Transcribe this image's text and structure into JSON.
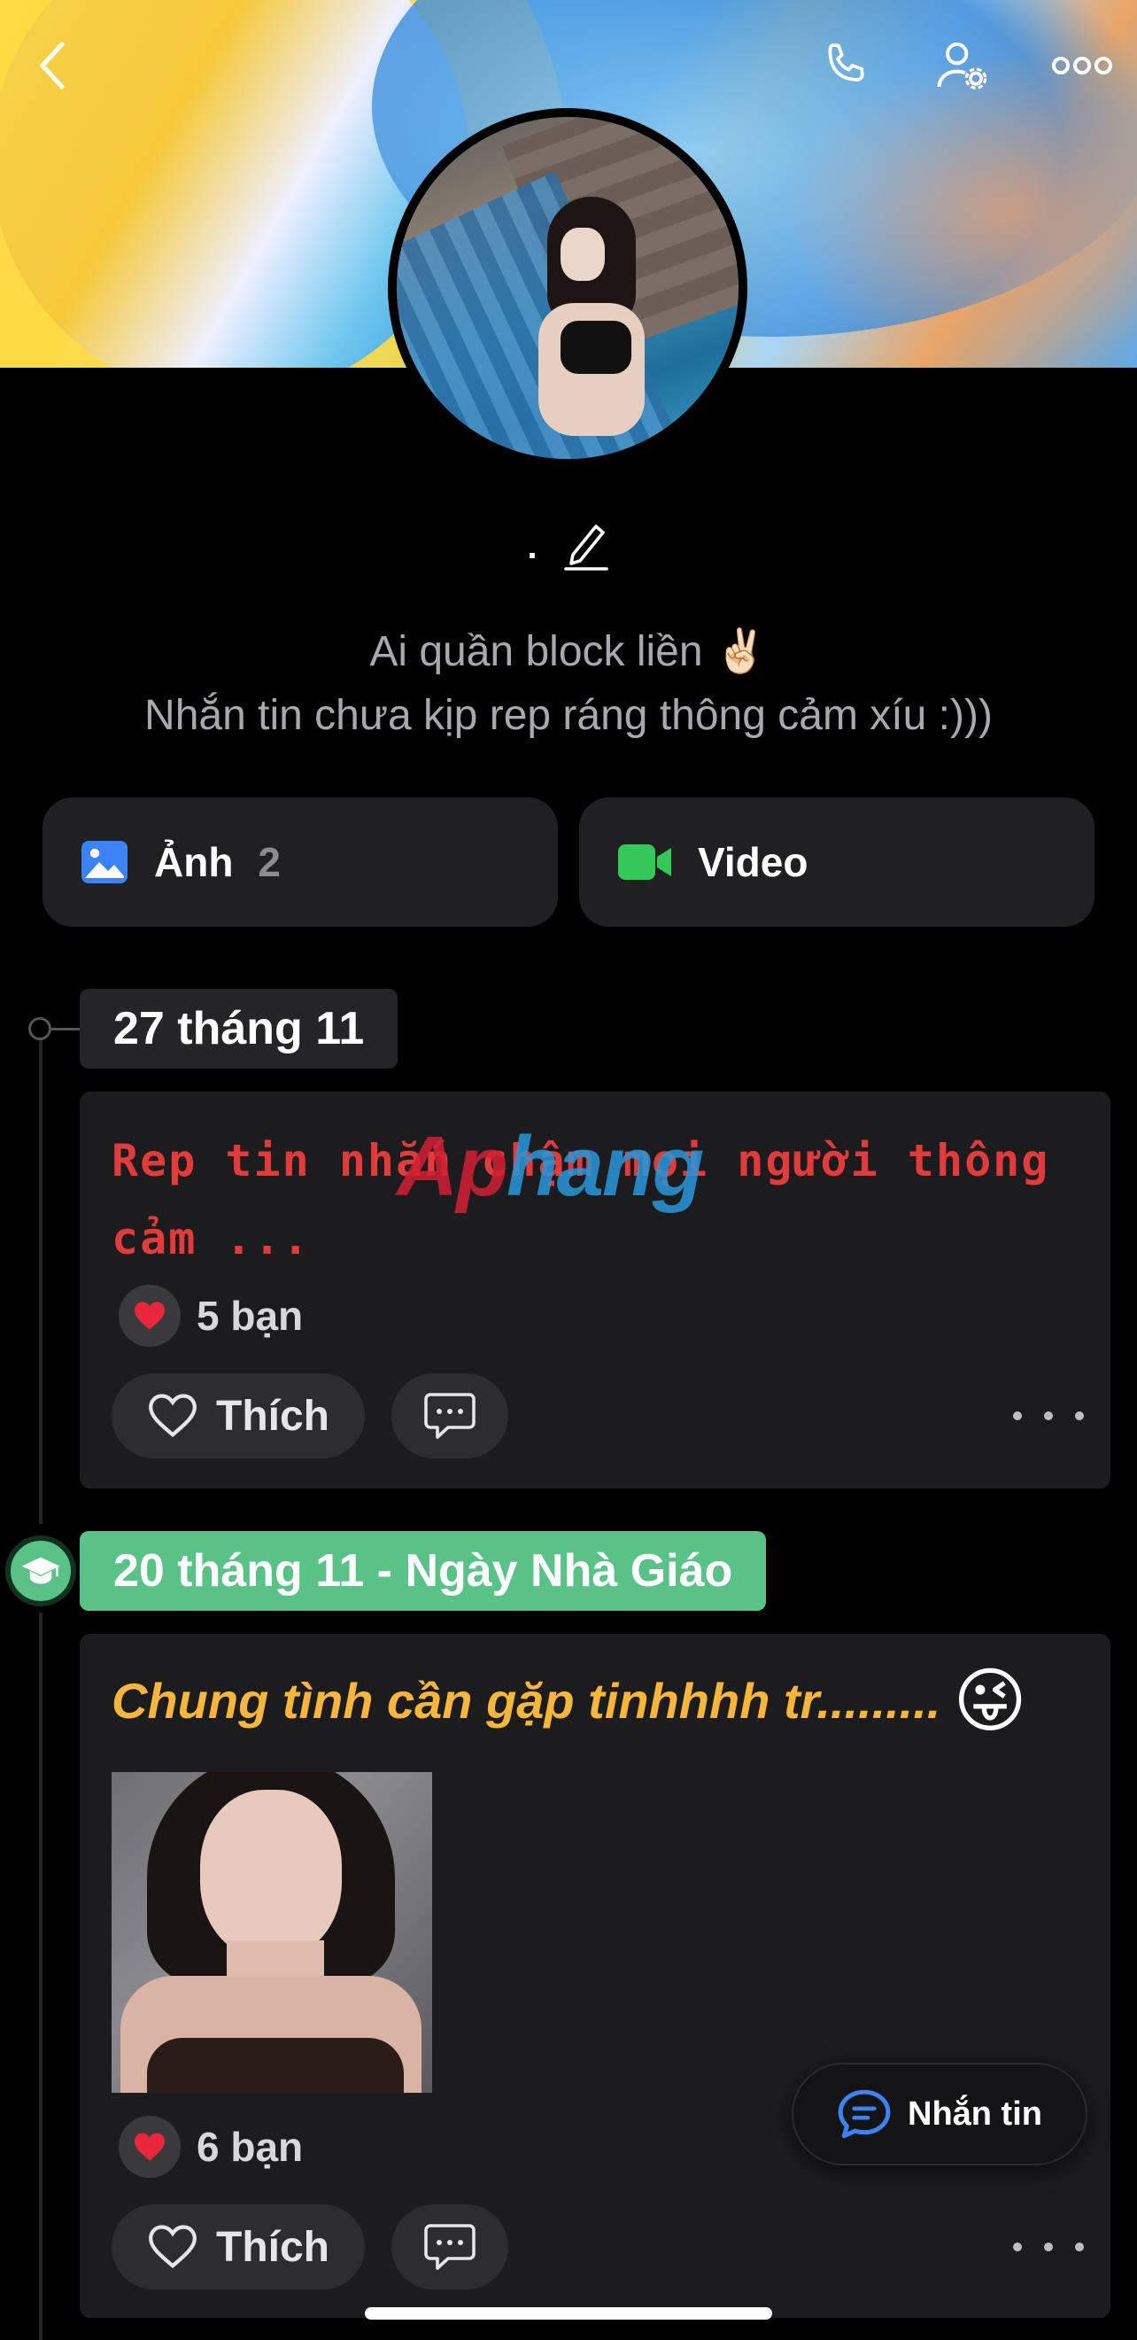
{
  "profile": {
    "name": ".",
    "bio_line1": "Ai quần block liền ✌🏻",
    "bio_line2": "Nhắn tin chưa kịp rep ráng thông cảm xíu :)))"
  },
  "media": {
    "photos_label": "Ảnh",
    "photos_count": "2",
    "videos_label": "Video"
  },
  "posts": [
    {
      "date": "27 tháng 11",
      "text_line1": "Rep tin nhắn chậm mọi người thông",
      "text_line2": "cảm ...",
      "reaction_count": "5 bạn",
      "like_label": "Thích"
    },
    {
      "date": "20 tháng 11 - Ngày Nhà Giáo",
      "text": "Chung tình cần gặp tinhhhh tr.........",
      "emoji": "😜",
      "reaction_count": "6 bạn",
      "like_label": "Thích"
    }
  ],
  "watermark": {
    "part1": "Ap",
    "part2": "hang"
  },
  "message_button": {
    "label": "Nhắn tin"
  },
  "colors": {
    "accent_blue": "#3b82f6",
    "video_green": "#34c759",
    "teacher_day_green": "#58c287",
    "red_post": "#e23b3b",
    "yellow_post": "#f6b63c"
  },
  "icons": [
    "back-icon",
    "phone-icon",
    "user-settings-icon",
    "more-icon",
    "edit-pencil-icon",
    "image-icon",
    "video-camera-icon",
    "heart-icon",
    "like-heart-outline-icon",
    "comment-icon",
    "graduation-cap-icon",
    "chat-bubble-icon"
  ]
}
